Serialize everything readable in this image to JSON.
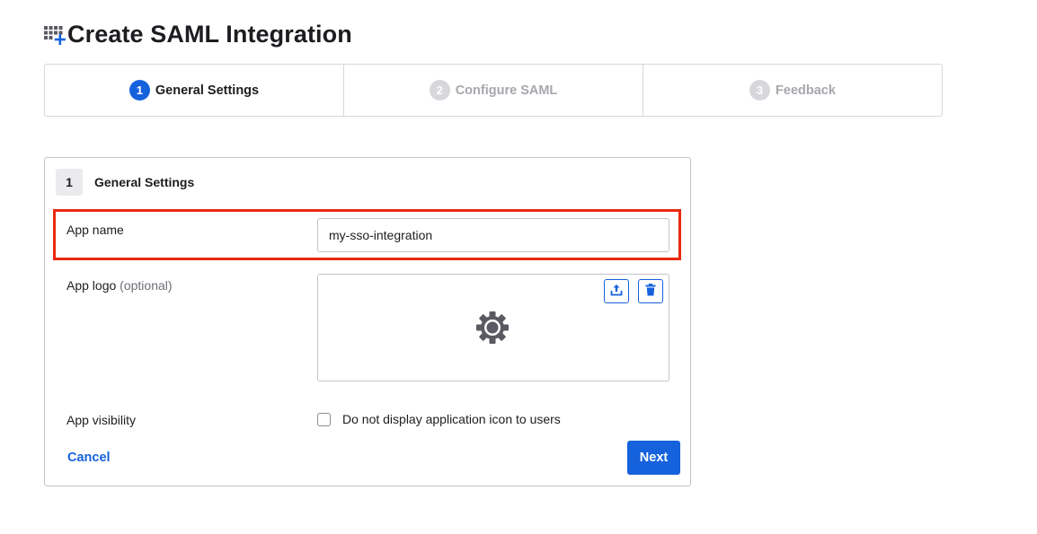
{
  "header": {
    "title": "Create SAML Integration",
    "icon": "grid-add-icon",
    "accent_color": "#1662dd"
  },
  "stepper": {
    "steps": [
      {
        "number": "1",
        "label": "General Settings",
        "state": "active"
      },
      {
        "number": "2",
        "label": "Configure SAML",
        "state": "inactive"
      },
      {
        "number": "3",
        "label": "Feedback",
        "state": "inactive"
      }
    ]
  },
  "form": {
    "step_number": "1",
    "title": "General Settings",
    "app_name": {
      "label": "App name",
      "value": "my-sso-integration"
    },
    "app_logo": {
      "label": "App logo",
      "optional": "(optional)",
      "placeholder_icon": "gear-icon",
      "upload_icon": "upload-icon",
      "delete_icon": "trash-icon"
    },
    "app_visibility": {
      "label": "App visibility",
      "checkbox_label": "Do not display application icon to users",
      "checked": false
    },
    "cancel_label": "Cancel",
    "next_label": "Next"
  },
  "highlight_color": "#e8290f"
}
